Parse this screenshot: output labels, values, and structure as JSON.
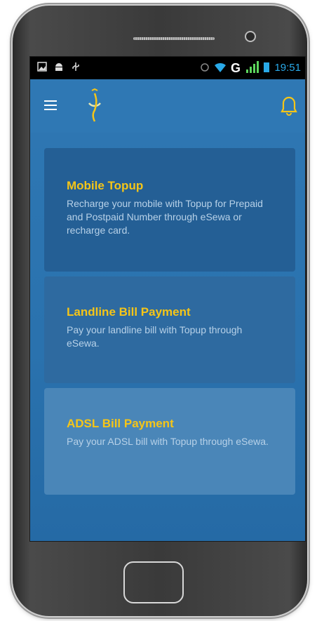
{
  "statusbar": {
    "time": "19:51",
    "left_icons": [
      "gallery-icon",
      "android-icon",
      "usb-icon"
    ],
    "right_icons": [
      "alarm-icon",
      "wifi-icon",
      "signal-icon",
      "battery-icon"
    ]
  },
  "appbar": {
    "menu_icon": "hamburger-menu-icon",
    "logo_icon": "esewa-logo-icon",
    "bell_icon": "notification-bell-icon"
  },
  "cards": [
    {
      "title": "Mobile Topup",
      "description": "Recharge your mobile with Topup for Prepaid and Postpaid Number through eSewa or recharge card."
    },
    {
      "title": "Landline Bill Payment",
      "description": "Pay your landline bill with Topup through eSewa."
    },
    {
      "title": "ADSL Bill Payment",
      "description": "Pay your ADSL bill with Topup through eSewa."
    }
  ],
  "colors": {
    "appbar": "#2f78b4",
    "title_accent": "#f5c518",
    "desc_text": "#b7d1e8",
    "time": "#29a9e8"
  }
}
